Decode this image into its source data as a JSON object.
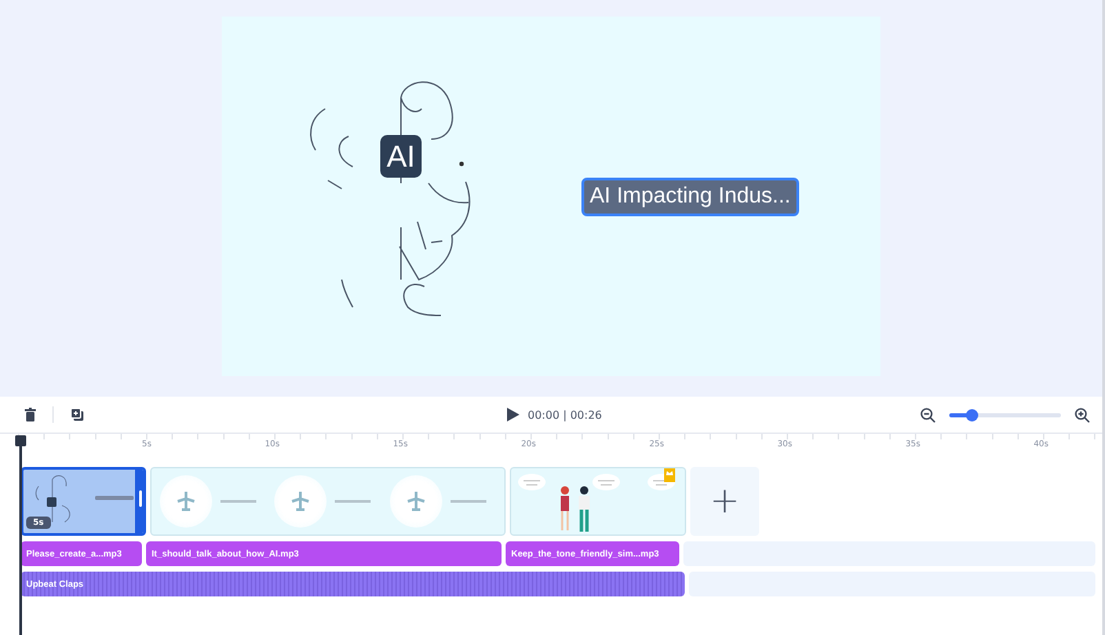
{
  "preview": {
    "logo_text": "AI",
    "caption": {
      "text": "AI Impacting Indus...",
      "selected": true
    }
  },
  "toolbar": {
    "time": "00:00 | 00:26",
    "zoom": {
      "level": 0.2
    }
  },
  "ruler": {
    "labels": [
      "5s",
      "10s",
      "15s",
      "20s",
      "25s",
      "30s",
      "35s",
      "40s"
    ]
  },
  "scenes": [
    {
      "kind": "doodle",
      "selected": true,
      "duration": "5s"
    },
    {
      "kind": "planes",
      "selected": false
    },
    {
      "kind": "characters",
      "selected": false,
      "premium": true
    }
  ],
  "add_scene": {
    "label": "+"
  },
  "voice_track": [
    {
      "name": "Please_create_a...mp3"
    },
    {
      "name": "It_should_talk_about_how_AI.mp3"
    },
    {
      "name": "Keep_the_tone_friendly_sim...mp3"
    }
  ],
  "music_track": [
    {
      "name": "Upbeat Claps"
    }
  ]
}
